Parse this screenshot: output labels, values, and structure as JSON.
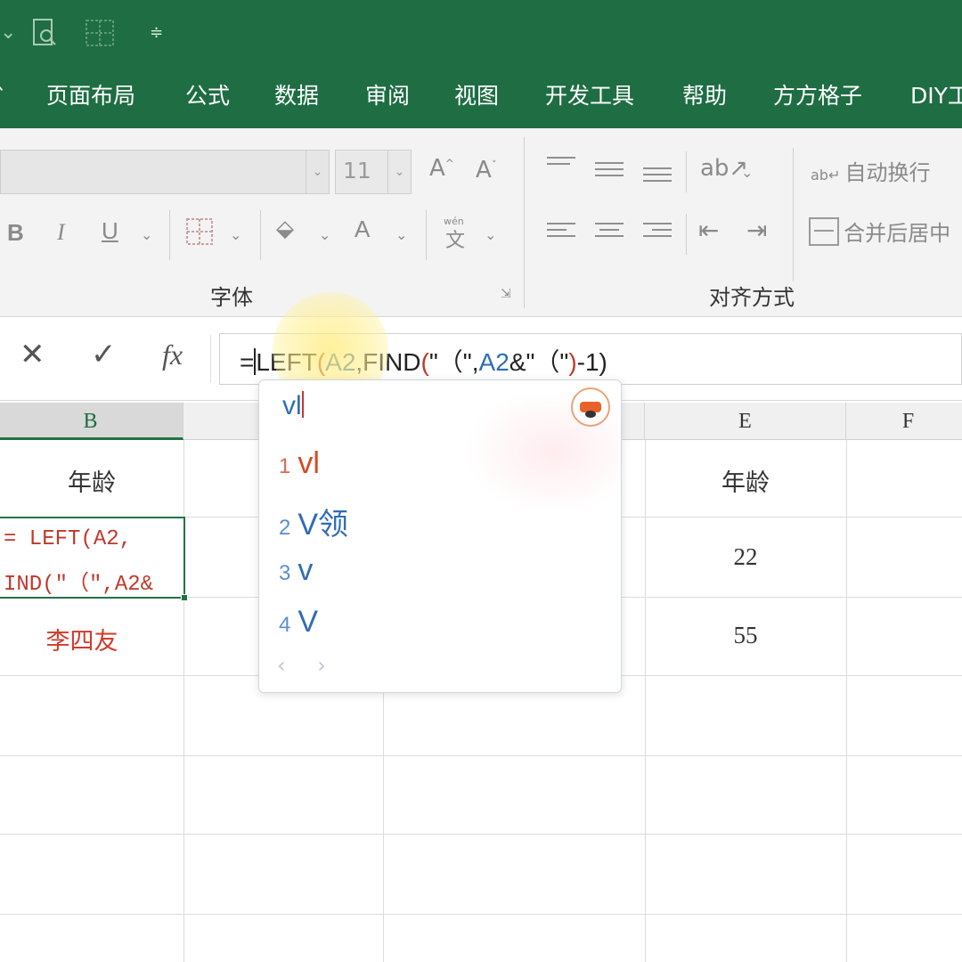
{
  "tabs": [
    "页面布局",
    "公式",
    "数据",
    "审阅",
    "视图",
    "开发工具",
    "帮助",
    "方方格子",
    "DIY工"
  ],
  "ribbon": {
    "font_size": "11",
    "font_group_label": "字体",
    "align_group_label": "对齐方式",
    "wrap_text": "自动换行",
    "merge_center": "合并后居中",
    "bold": "B",
    "italic": "I",
    "underline": "U",
    "grow_font": "A",
    "shrink_font": "A",
    "font_color": "A",
    "phonetic": "wén"
  },
  "formula_bar": {
    "fx": "fx",
    "cancel": "✕",
    "enter": "✓",
    "formula_parts": {
      "eq": "=",
      "p1": "LEFT",
      "p2": "(",
      "p3": "A2",
      "p4": ",FIND",
      "p5": "(",
      "p6": "\"（\",",
      "p7": "A2",
      "p8": "&\"（\"",
      "p9": ")",
      "p10": "-1)"
    }
  },
  "grid": {
    "columns": [
      "B",
      "E",
      "F"
    ],
    "header_cells": {
      "b1": "年龄",
      "e1": "年龄"
    },
    "active_cell_lines": [
      "= LEFT(A2,",
      "IND(″（″,A2&"
    ],
    "b3": "李四友",
    "e2": "22",
    "e3": "55"
  },
  "ime": {
    "composing": "vl",
    "candidates": [
      {
        "num": "1",
        "text": "vl"
      },
      {
        "num": "2",
        "text": "V领"
      },
      {
        "num": "3",
        "text": "v"
      },
      {
        "num": "4",
        "text": "V"
      }
    ],
    "nav": "‹ ›"
  },
  "colors": {
    "ribbon_green": "#1e6d43",
    "selection_green": "#217346",
    "candidate_accent": "#d84a22",
    "formula_ref_blue": "#2f6db5",
    "formula_paren_red": "#c0392b"
  }
}
